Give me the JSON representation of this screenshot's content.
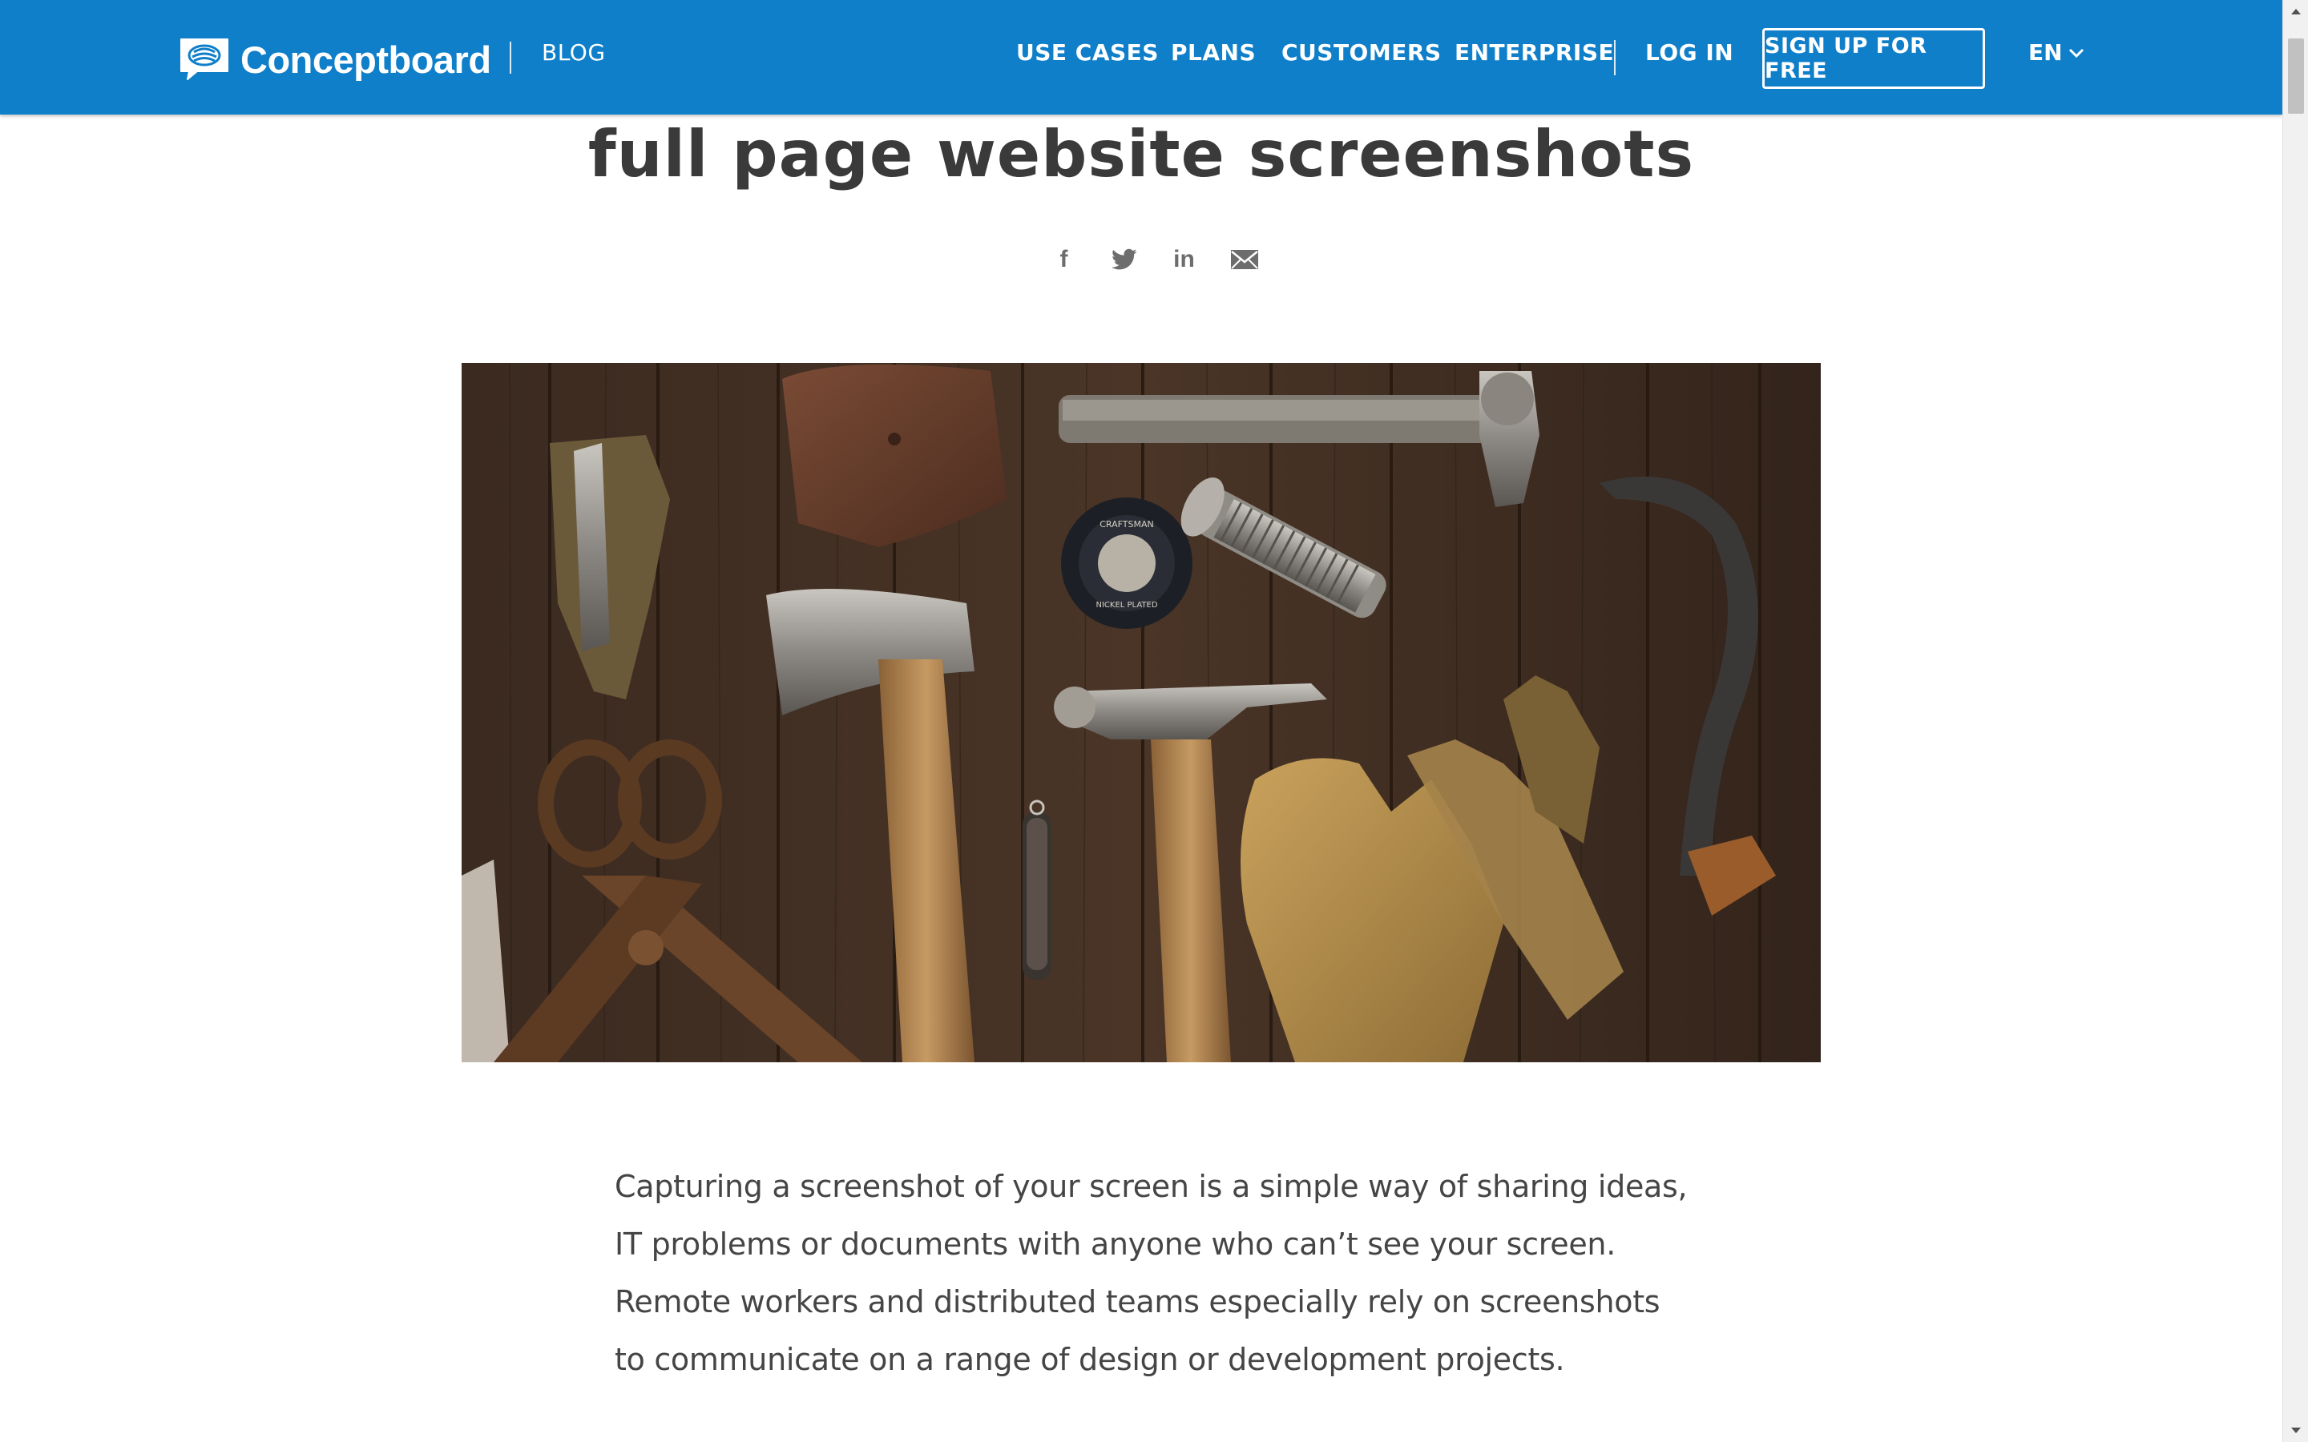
{
  "header": {
    "brand": "Conceptboard",
    "section": "BLOG",
    "nav": [
      "USE CASES",
      "PLANS",
      "CUSTOMERS",
      "ENTERPRISE"
    ],
    "login": "LOG IN",
    "signup": "SIGN UP FOR FREE",
    "language": "EN"
  },
  "article": {
    "title": "full page website screenshots",
    "share_icons": [
      "facebook-icon",
      "twitter-icon",
      "linkedin-icon",
      "email-icon"
    ],
    "share_glyphs": {
      "facebook": "f",
      "linkedin": "in"
    },
    "hero_image": {
      "tape_label_top": "CRAFTSMAN",
      "tape_label_bottom": "NICKEL PLATED"
    },
    "intro": "Capturing a screenshot of your screen is a simple way of sharing ideas, IT problems or documents with anyone who can’t see your screen. Remote workers and distributed teams especially rely on screenshots to communicate on a range of design or development projects."
  },
  "colors": {
    "brand_blue": "#0f7fca",
    "title_text": "#3a3a3a",
    "body_text": "#454545",
    "icon_gray": "#6d6d6d"
  }
}
